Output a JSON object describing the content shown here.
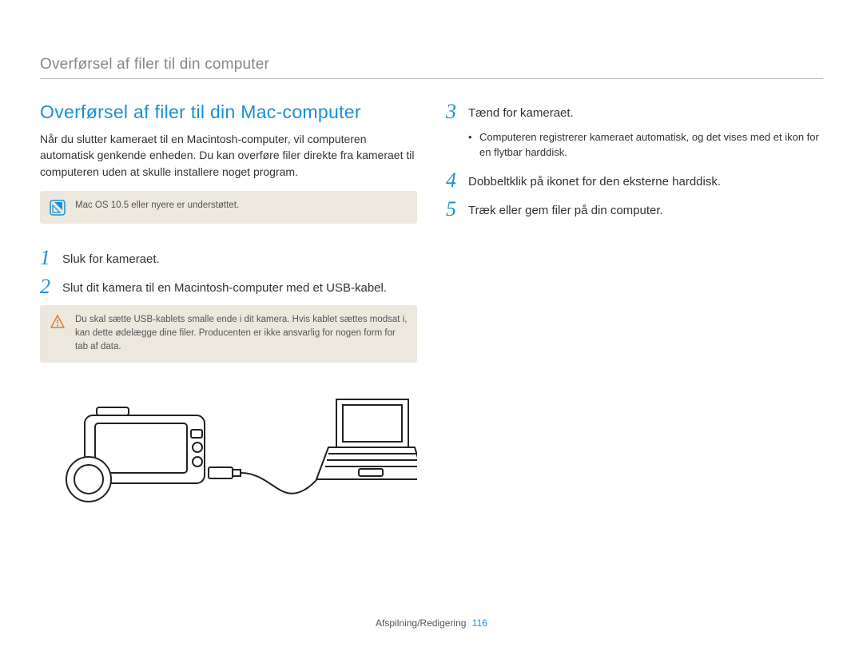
{
  "header": {
    "breadcrumb": "Overførsel af filer til din computer"
  },
  "left": {
    "section_title": "Overførsel af filer til din Mac-computer",
    "intro": "Når du slutter kameraet til en Macintosh-computer, vil computeren automatisk genkende enheden. Du kan overføre filer direkte fra kameraet til computeren uden at skulle installere noget program.",
    "note1": "Mac OS 10.5 eller nyere er understøttet.",
    "step1_num": "1",
    "step1_text": "Sluk for kameraet.",
    "step2_num": "2",
    "step2_text": "Slut dit kamera til en Macintosh-computer med et USB-kabel.",
    "warning": "Du skal sætte USB-kablets smalle ende i dit kamera. Hvis kablet sættes modsat i, kan dette ødelægge dine filer. Producenten er ikke ansvarlig for nogen form for tab af data."
  },
  "right": {
    "step3_num": "3",
    "step3_text": "Tænd for kameraet.",
    "step3_bullet": "Computeren registrerer kameraet automatisk, og det vises med et ikon for en flytbar harddisk.",
    "step4_num": "4",
    "step4_text": "Dobbeltklik på ikonet for den eksterne harddisk.",
    "step5_num": "5",
    "step5_text": "Træk eller gem filer på din computer."
  },
  "footer": {
    "section": "Afspilning/Redigering",
    "page": "116"
  }
}
